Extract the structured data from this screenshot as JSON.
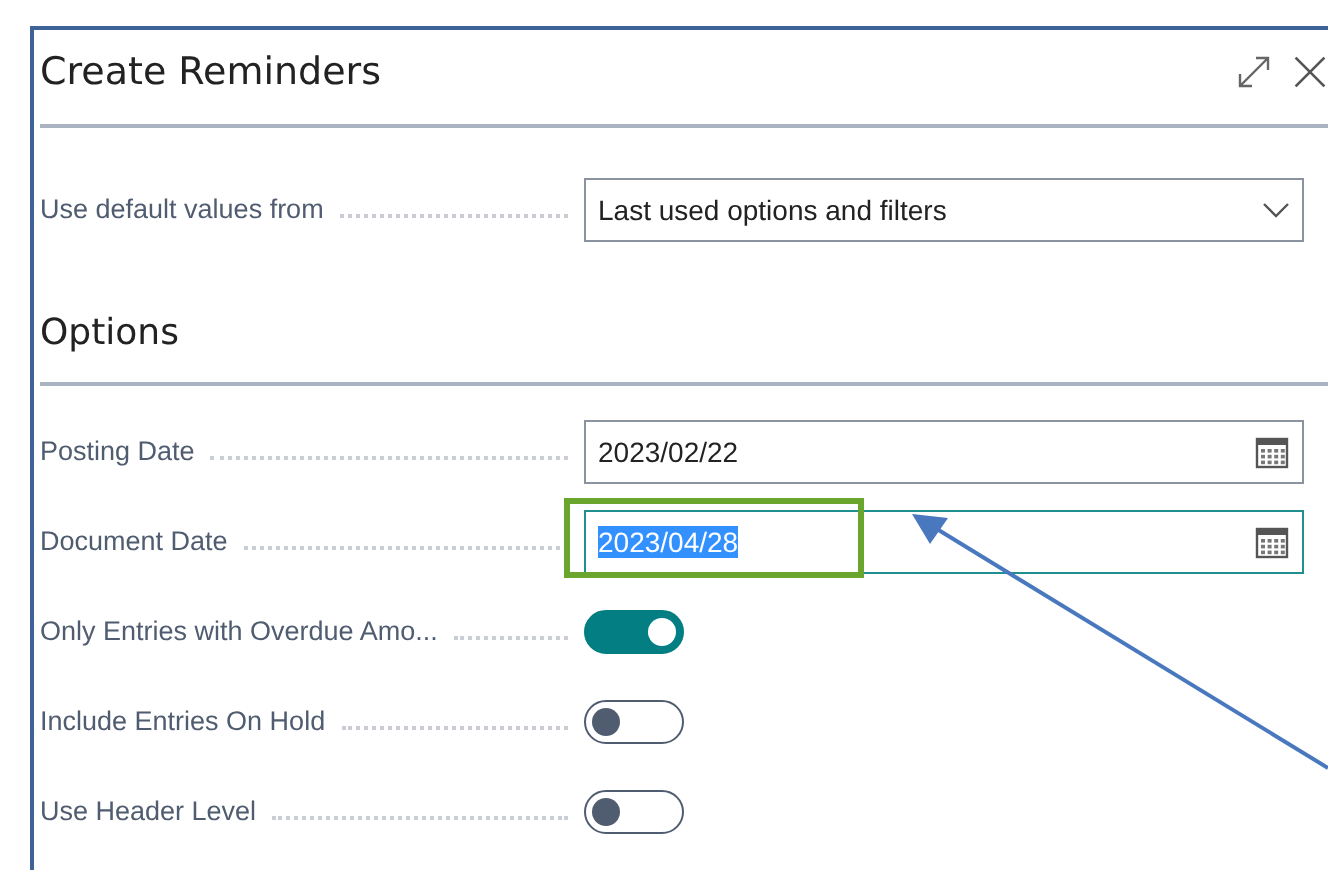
{
  "dialog": {
    "title": "Create Reminders"
  },
  "defaults": {
    "label": "Use default values from",
    "value": "Last used options and filters"
  },
  "options": {
    "heading": "Options",
    "fields": [
      {
        "kind": "date",
        "label": "Posting Date",
        "value": "2023/02/22",
        "focused": false,
        "highlighted": false
      },
      {
        "kind": "date",
        "label": "Document Date",
        "value": "2023/04/28",
        "focused": true,
        "highlighted": true
      },
      {
        "kind": "toggle",
        "label": "Only Entries with Overdue Amo...",
        "on": true
      },
      {
        "kind": "toggle",
        "label": "Include Entries On Hold",
        "on": false
      },
      {
        "kind": "toggle",
        "label": "Use Header Level",
        "on": false
      }
    ]
  }
}
